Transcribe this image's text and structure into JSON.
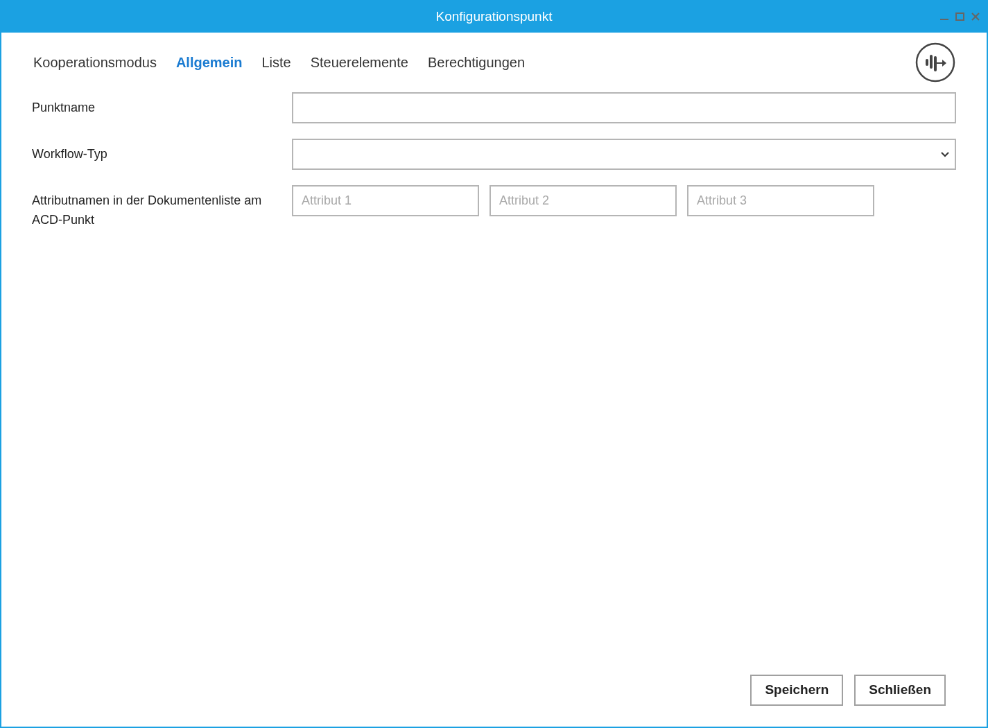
{
  "window": {
    "title": "Konfigurationspunkt"
  },
  "tabs": [
    {
      "label": "Kooperationsmodus",
      "selected": false
    },
    {
      "label": "Allgemein",
      "selected": true
    },
    {
      "label": "Liste",
      "selected": false
    },
    {
      "label": "Steuerelemente",
      "selected": false
    },
    {
      "label": "Berechtigungen",
      "selected": false
    }
  ],
  "form": [
    {
      "kind": "text",
      "label": "Punktname"
    },
    {
      "kind": "select",
      "label": "Workflow-Typ"
    },
    {
      "kind": "multi",
      "label": "Attributnamen in der Dokumentenliste am ACD-Punkt",
      "fields": [
        {
          "placeholder": "Attribut 1"
        },
        {
          "placeholder": "Attribut 2"
        },
        {
          "placeholder": "Attribut 3"
        }
      ]
    }
  ],
  "buttons": [
    "Speichern",
    "Schließen"
  ]
}
